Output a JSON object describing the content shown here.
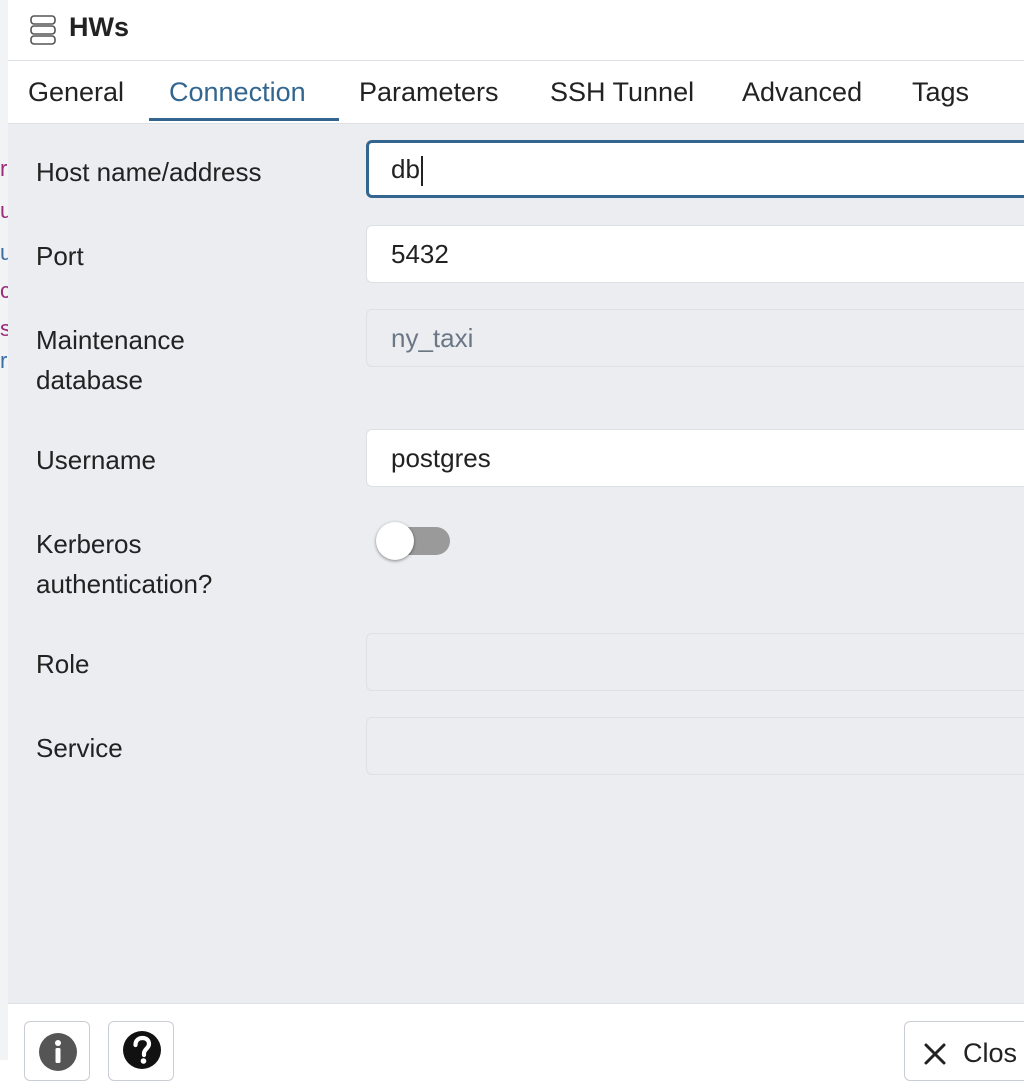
{
  "dialog": {
    "title": "HWs",
    "title_icon": "server-icon"
  },
  "tabs": [
    {
      "label": "General"
    },
    {
      "label": "Connection",
      "active": true
    },
    {
      "label": "Parameters"
    },
    {
      "label": "SSH Tunnel"
    },
    {
      "label": "Advanced"
    },
    {
      "label": "Tags"
    }
  ],
  "form": {
    "host": {
      "label": "Host name/address",
      "value": "db"
    },
    "port": {
      "label": "Port",
      "value": "5432"
    },
    "maintenance_db": {
      "label_line1": "Maintenance",
      "label_line2": "database",
      "value": "ny_taxi"
    },
    "username": {
      "label": "Username",
      "value": "postgres"
    },
    "kerberos": {
      "label_line1": "Kerberos",
      "label_line2": "authentication?",
      "enabled": false
    },
    "role": {
      "label": "Role",
      "value": ""
    },
    "service": {
      "label": "Service",
      "value": ""
    }
  },
  "footer": {
    "info_icon": "info-icon",
    "help_icon": "help-icon",
    "close_label": "Clos",
    "close_icon": "close-icon"
  },
  "colors": {
    "accent": "#326690",
    "panel_bg": "#ebedf0",
    "toggle_off": "#9a9a9a"
  }
}
